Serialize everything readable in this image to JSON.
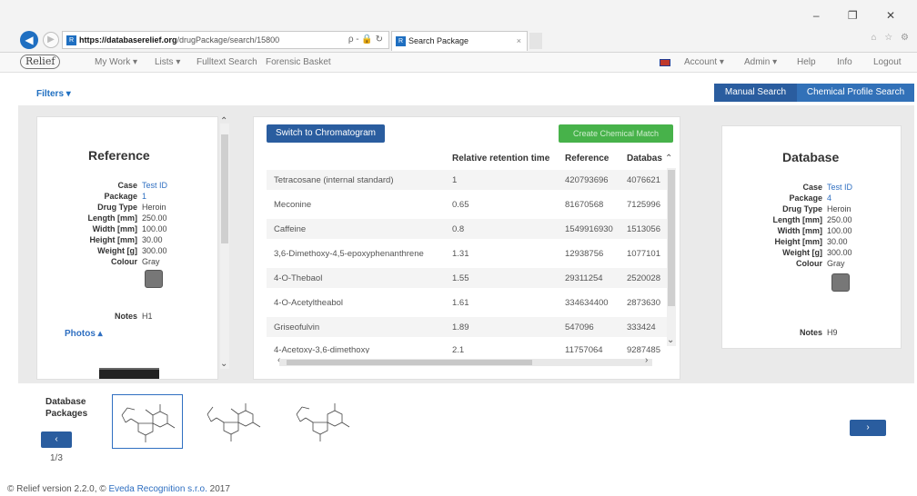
{
  "browser": {
    "url_host": "https://databaserelief.org",
    "url_path": "/drugPackage/search/15800",
    "tab_title": "Search Package",
    "address_tools": "ρ - 🔒 ↻",
    "window_controls": "– ❐ ✕",
    "toolbar_icons": "⌂ ☆ ⚙"
  },
  "nav": {
    "logo": "Relief",
    "my_work": "My Work ▾",
    "lists": "Lists ▾",
    "fulltext": "Fulltext Search",
    "forensic": "Forensic Basket",
    "account": "Account ▾",
    "admin": "Admin ▾",
    "help": "Help",
    "info": "Info",
    "logout": "Logout"
  },
  "filters": "Filters",
  "buttons": {
    "manual_search": "Manual Search",
    "chemical_profile": "Chemical Profile Search",
    "switch_chromatogram": "Switch to Chromatogram",
    "create_match": "Create Chemical Match"
  },
  "reference": {
    "title": "Reference",
    "labels": {
      "case": "Case",
      "package": "Package",
      "drug_type": "Drug Type",
      "length": "Length [mm]",
      "width": "Width [mm]",
      "height": "Height [mm]",
      "weight": "Weight [g]",
      "colour": "Colour",
      "notes": "Notes"
    },
    "values": {
      "case": "Test ID",
      "package": "1",
      "drug_type": "Heroin",
      "length": "250.00",
      "width": "100.00",
      "height": "30.00",
      "weight": "300.00",
      "colour": "Gray",
      "notes": "H1"
    },
    "photos": "Photos"
  },
  "table": {
    "headers": {
      "relative": "Relative retention time",
      "reference": "Reference",
      "database": "Databas"
    },
    "rows": [
      {
        "name": "Tetracosane (internal standard)",
        "rt": "1",
        "ref": "420793696",
        "db": "4076621"
      },
      {
        "name": "Meconine",
        "rt": "0.65",
        "ref": "81670568",
        "db": "7125996"
      },
      {
        "name": "Caffeine",
        "rt": "0.8",
        "ref": "1549916930",
        "db": "1513056"
      },
      {
        "name": "3,6-Dimethoxy-4,5-epoxyphenanthrene",
        "rt": "1.31",
        "ref": "12938756",
        "db": "1077101"
      },
      {
        "name": "4-O-Thebaol",
        "rt": "1.55",
        "ref": "29311254",
        "db": "2520028"
      },
      {
        "name": "4-O-Acetyltheabol",
        "rt": "1.61",
        "ref": "334634400",
        "db": "2873630"
      },
      {
        "name": "Griseofulvin",
        "rt": "1.89",
        "ref": "547096",
        "db": "333424"
      },
      {
        "name": "4-Acetoxy-3,6-dimethoxy",
        "rt": "2.1",
        "ref": "11757064",
        "db": "9287485"
      }
    ]
  },
  "database": {
    "title": "Database",
    "values": {
      "case": "Test ID",
      "package": "4",
      "drug_type": "Heroin",
      "length": "250.00",
      "width": "100.00",
      "height": "30.00",
      "weight": "300.00",
      "colour": "Gray",
      "notes": "H9"
    }
  },
  "packages": {
    "label_line1": "Database",
    "label_line2": "Packages",
    "pager": "1/3"
  },
  "footer": {
    "text": "© Relief version 2.2.0, ©",
    "company": "Eveda Recognition s.r.o.",
    "year": "2017"
  },
  "colors": {
    "primary": "#2a5d9f",
    "accent": "#47b24a",
    "link": "#2f6fc1"
  }
}
